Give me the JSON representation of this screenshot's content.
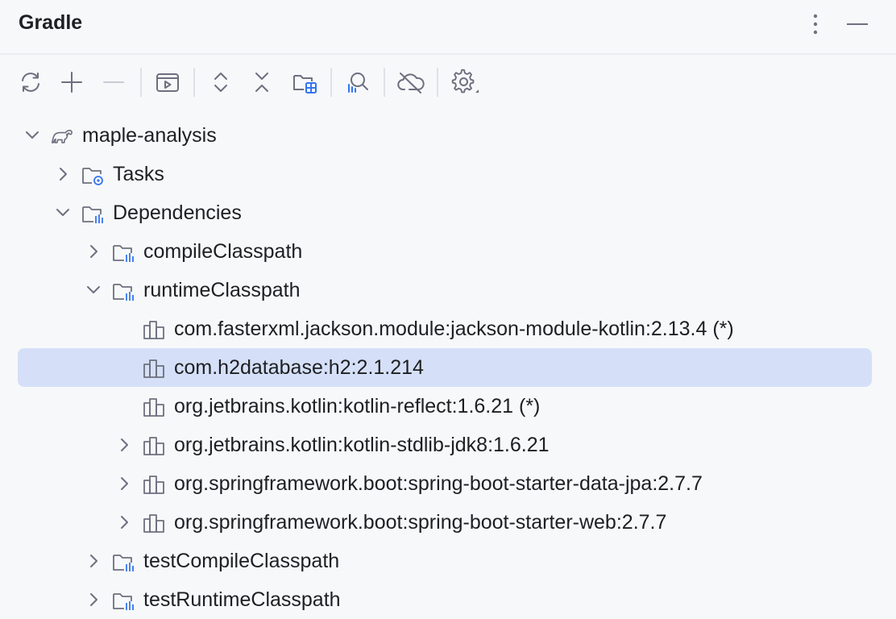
{
  "header": {
    "title": "Gradle",
    "more_icon": "vertical-ellipsis-icon",
    "hide_icon": "minimize-icon"
  },
  "toolbar": {
    "buttons": [
      {
        "name": "reload-all-gradle-projects",
        "icon": "refresh-icon"
      },
      {
        "name": "link-gradle-project",
        "icon": "plus-icon"
      },
      {
        "name": "unlink-gradle-project",
        "icon": "minus-icon"
      },
      {
        "name": "execute-gradle-task",
        "icon": "run-window-icon"
      },
      {
        "name": "expand-all",
        "icon": "expand-all-icon"
      },
      {
        "name": "collapse-all",
        "icon": "collapse-all-icon"
      },
      {
        "name": "show-project-folder",
        "icon": "folder-grid-icon"
      },
      {
        "name": "analyze-dependencies",
        "icon": "analyze-icon"
      },
      {
        "name": "toggle-offline-mode",
        "icon": "cloud-offline-icon"
      },
      {
        "name": "build-tool-settings",
        "icon": "gear-icon"
      }
    ]
  },
  "tree": {
    "items": [
      {
        "label": "maple-analysis",
        "depth": 0,
        "expanded": true,
        "has_children": true,
        "icon": "gradle-elephant-icon"
      },
      {
        "label": "Tasks",
        "depth": 1,
        "expanded": false,
        "has_children": true,
        "icon": "folder-gear-icon"
      },
      {
        "label": "Dependencies",
        "depth": 1,
        "expanded": true,
        "has_children": true,
        "icon": "folder-library-icon"
      },
      {
        "label": "compileClasspath",
        "depth": 2,
        "expanded": false,
        "has_children": true,
        "icon": "folder-library-icon"
      },
      {
        "label": "runtimeClasspath",
        "depth": 2,
        "expanded": true,
        "has_children": true,
        "icon": "folder-library-icon"
      },
      {
        "label": "com.fasterxml.jackson.module:jackson-module-kotlin:2.13.4 (*)",
        "depth": 3,
        "expanded": false,
        "has_children": false,
        "icon": "library-icon"
      },
      {
        "label": "com.h2database:h2:2.1.214",
        "depth": 3,
        "expanded": false,
        "has_children": false,
        "icon": "library-icon",
        "selected": true
      },
      {
        "label": "org.jetbrains.kotlin:kotlin-reflect:1.6.21 (*)",
        "depth": 3,
        "expanded": false,
        "has_children": false,
        "icon": "library-icon"
      },
      {
        "label": "org.jetbrains.kotlin:kotlin-stdlib-jdk8:1.6.21",
        "depth": 3,
        "expanded": false,
        "has_children": true,
        "icon": "library-icon"
      },
      {
        "label": "org.springframework.boot:spring-boot-starter-data-jpa:2.7.7",
        "depth": 3,
        "expanded": false,
        "has_children": true,
        "icon": "library-icon"
      },
      {
        "label": "org.springframework.boot:spring-boot-starter-web:2.7.7",
        "depth": 3,
        "expanded": false,
        "has_children": true,
        "icon": "library-icon"
      },
      {
        "label": "testCompileClasspath",
        "depth": 2,
        "expanded": false,
        "has_children": true,
        "icon": "folder-library-icon"
      },
      {
        "label": "testRuntimeClasspath",
        "depth": 2,
        "expanded": false,
        "has_children": true,
        "icon": "folder-library-icon"
      }
    ]
  },
  "colors": {
    "background": "#f7f8fa",
    "selection": "#d5e0f8",
    "icon_gray": "#6c707e",
    "icon_blue": "#3574f0"
  }
}
